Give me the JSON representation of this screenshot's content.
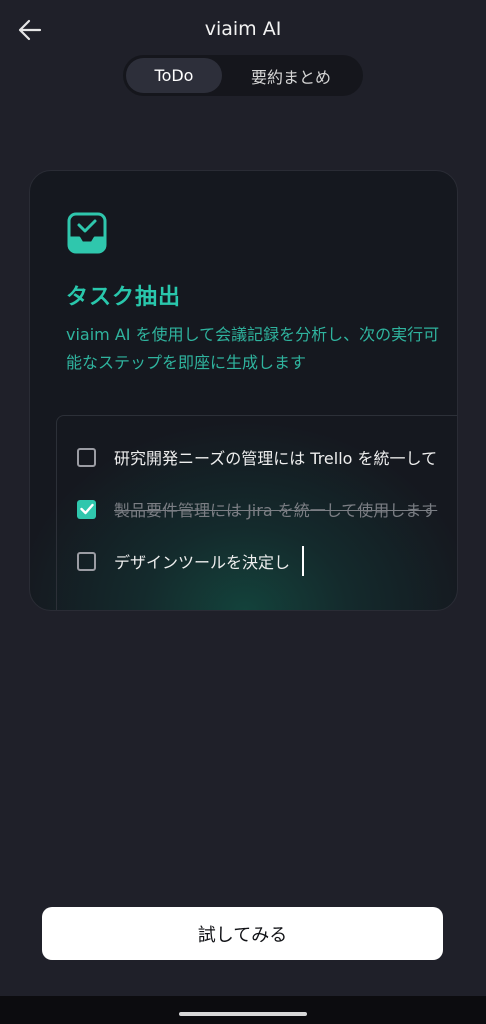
{
  "header": {
    "title": "viaim AI",
    "back_icon": "arrow-left-icon"
  },
  "tabs": [
    {
      "label": "ToDo",
      "selected": true
    },
    {
      "label": "要約まとめ",
      "selected": false
    }
  ],
  "card": {
    "icon": "inbox-check-icon",
    "title": "タスク抽出",
    "description": "viaim AI を使用して会議記録を分析し、次の実行可能なステップを即座に生成します",
    "tasks": [
      {
        "text": "研究開発ニーズの管理には Trello を統一して",
        "checked": false
      },
      {
        "text": "製品要件管理には Jira を統一して使用します",
        "checked": true
      },
      {
        "text": "デザインツールを決定し",
        "checked": false
      }
    ]
  },
  "actions": {
    "try_label": "試してみる"
  },
  "colors": {
    "background": "#1f2029",
    "accent": "#2fc7ad",
    "button": "#ffffff"
  }
}
